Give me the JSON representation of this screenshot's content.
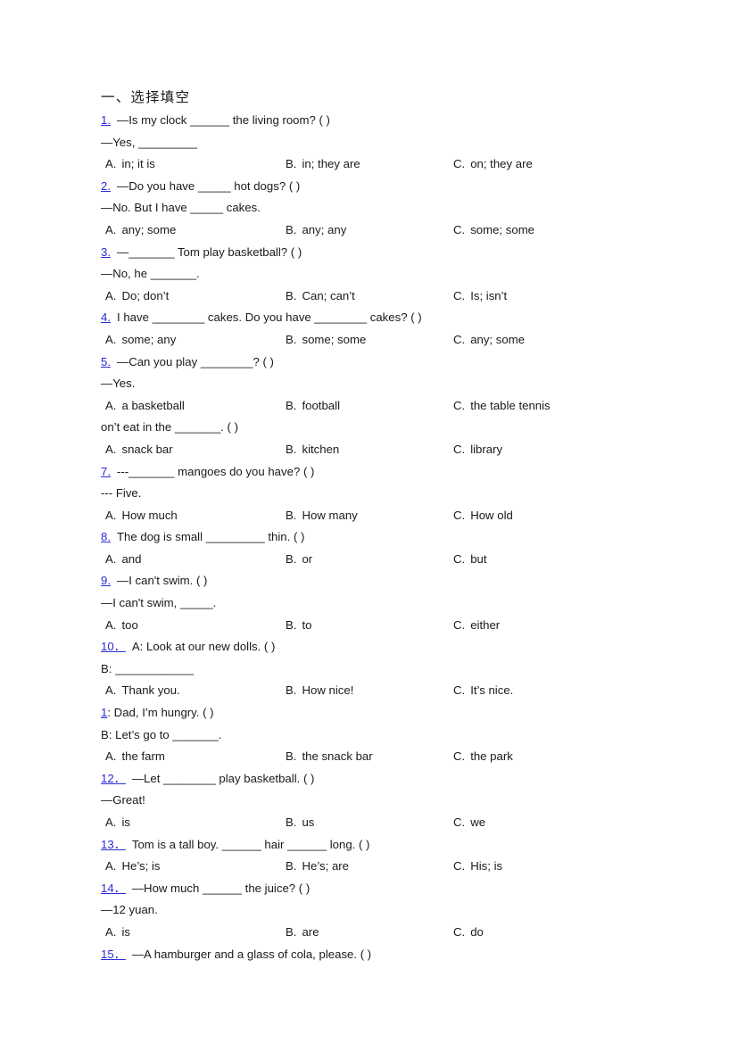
{
  "document": {
    "section_heading": "一、选择填空",
    "option_labels": [
      "A.",
      "B.",
      "C."
    ],
    "accent_color": "#2b2bd6",
    "text_color": "#1a1a1a",
    "background_color": "#ffffff",
    "questions": [
      {
        "number": "1.",
        "stem": "—Is my clock ______ the living room? (  )",
        "continuation": "—Yes, _________",
        "options": [
          "in; it is",
          "in; they are",
          "on; they are"
        ]
      },
      {
        "number": "2.",
        "stem": "—Do you have _____ hot dogs? (  )",
        "continuation": "—No. But I have _____ cakes.",
        "options": [
          "any; some",
          "any; any",
          "some; some"
        ]
      },
      {
        "number": "3.",
        "stem": "—_______ Tom play basketball? (   )",
        "continuation": "—No, he _______.",
        "options": [
          "Do; don’t",
          "Can; can’t",
          "Is; isn’t"
        ]
      },
      {
        "number": "4.",
        "stem": "I have ________ cakes. Do you have ________ cakes? (  )",
        "continuation": "",
        "options": [
          "some; any",
          "some; some",
          "any; some"
        ]
      },
      {
        "number": "5.",
        "stem": "—Can you play ________? (  )",
        "continuation": "—Yes.",
        "options": [
          "a basketball",
          "football",
          "the table tennis"
        ]
      },
      {
        "number": "",
        "stem": "on’t eat in the _______. (  )",
        "continuation": "",
        "options": [
          "snack bar",
          "kitchen",
          "library"
        ]
      },
      {
        "number": "7.",
        "stem": "---_______ mangoes do you have? (   )",
        "continuation": "--- Five.",
        "options": [
          "How much",
          "How many",
          "How old"
        ]
      },
      {
        "number": "8.",
        "stem": "The dog is small _________ thin. (   )",
        "continuation": "",
        "options": [
          "and",
          "or",
          "but"
        ]
      },
      {
        "number": "9.",
        "stem": "—I can't swim. (   )",
        "continuation": "—I can't swim, _____.",
        "options": [
          "too",
          "to",
          "either"
        ]
      },
      {
        "number": "10．",
        "stem": "A: Look at our new dolls. (   )",
        "continuation": "B: ____________",
        "options": [
          "Thank you.",
          "How nice!",
          "It’s nice."
        ]
      },
      {
        "number": "1",
        "number_suffix": ":",
        "stem": " Dad, I’m hungry. (  )",
        "continuation": "B: Let’s go to _______.",
        "options": [
          "the farm",
          "the snack bar",
          "the park"
        ]
      },
      {
        "number": "12．",
        "stem": "—Let ________ play basketball. (   )",
        "continuation": "—Great!",
        "options": [
          "is",
          "us",
          "we"
        ]
      },
      {
        "number": "13．",
        "stem": "Tom is a tall boy. ______ hair ______ long. (  )",
        "continuation": "",
        "options": [
          "He’s; is",
          "He’s; are",
          "His; is"
        ]
      },
      {
        "number": "14．",
        "stem": "—How much ______ the juice? (  )",
        "continuation": "—12 yuan.",
        "options": [
          "is",
          "are",
          "do"
        ]
      },
      {
        "number": "15．",
        "stem": "—A hamburger and a glass of cola, please. (   )",
        "continuation": "",
        "options": []
      }
    ]
  }
}
